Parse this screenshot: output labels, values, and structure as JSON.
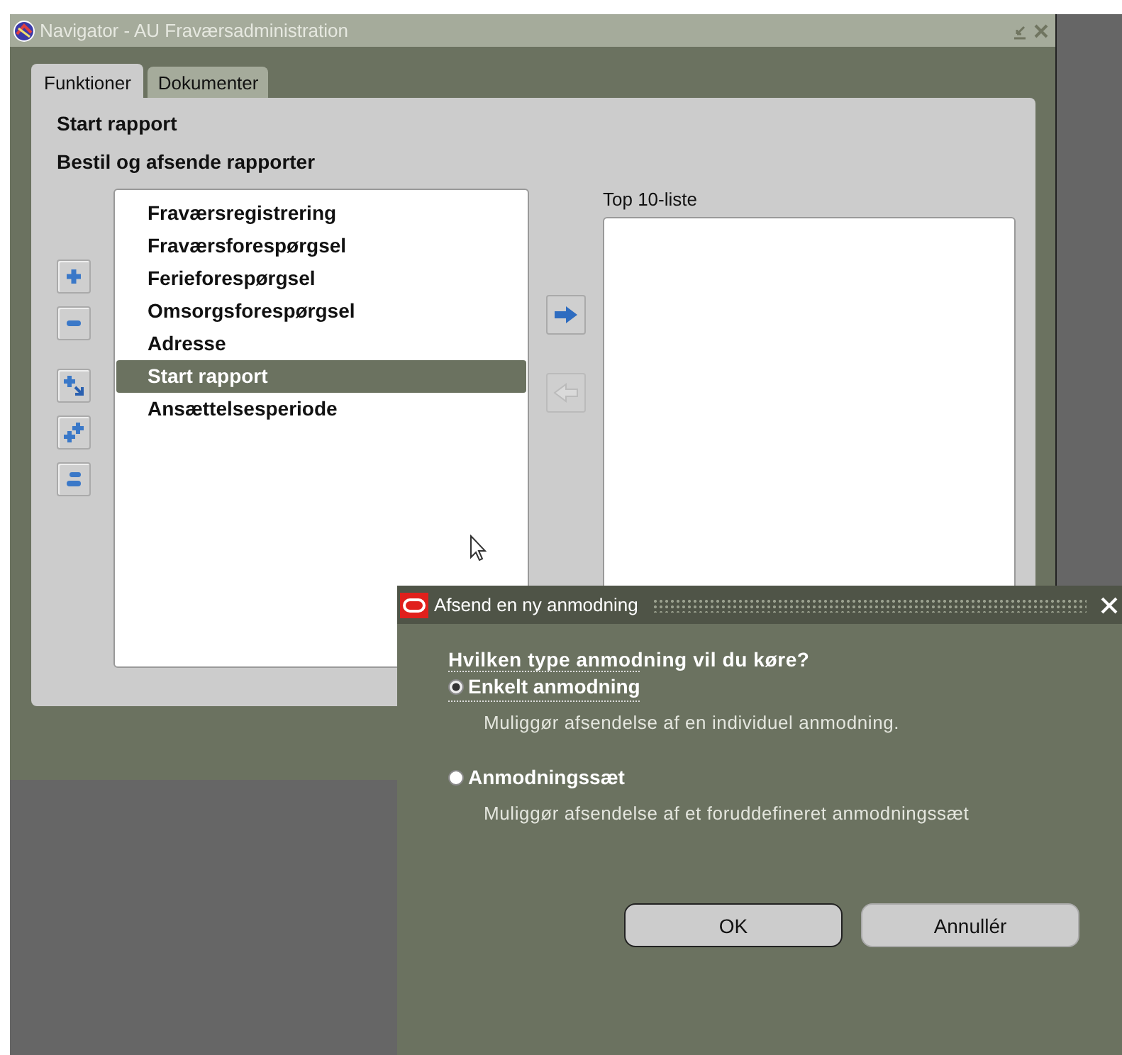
{
  "window": {
    "title": "Navigator - AU Fraværsadministration"
  },
  "tabs": [
    {
      "label": "Funktioner",
      "selected": true
    },
    {
      "label": "Dokumenter",
      "selected": false
    }
  ],
  "heading": "Start rapport",
  "subheading": "Bestil og afsende rapporter",
  "tree_buttons": [
    {
      "kind": "expand"
    },
    {
      "kind": "collapse"
    },
    {
      "kind": "expand_branch"
    },
    {
      "kind": "expand_all"
    },
    {
      "kind": "collapse_all"
    }
  ],
  "functions": [
    {
      "label": "Fraværsregistrering",
      "selected": false
    },
    {
      "label": "Fraværsforespørgsel",
      "selected": false
    },
    {
      "label": "Ferieforespørgsel",
      "selected": false
    },
    {
      "label": "Omsorgsforespørgsel",
      "selected": false
    },
    {
      "label": "Adresse",
      "selected": false
    },
    {
      "label": "Start rapport",
      "selected": true
    },
    {
      "label": "Ansættelsesperiode",
      "selected": false
    }
  ],
  "transfer_buttons": [
    {
      "kind": "add",
      "disabled": false
    },
    {
      "kind": "remove",
      "disabled": true
    }
  ],
  "top10": {
    "label": "Top 10-liste"
  },
  "dialog": {
    "title": "Afsend en ny anmodning",
    "question": "Hvilken type anmodning vil du køre?",
    "options": [
      {
        "label": "Enkelt anmodning",
        "description": "Muliggør afsendelse af en individuel anmodning.",
        "selected": true
      },
      {
        "label": "Anmodningssæt",
        "description": "Muliggør afsendelse af et foruddefineret anmodningssæt",
        "selected": false
      }
    ],
    "buttons": [
      "OK",
      "Annullér"
    ]
  }
}
